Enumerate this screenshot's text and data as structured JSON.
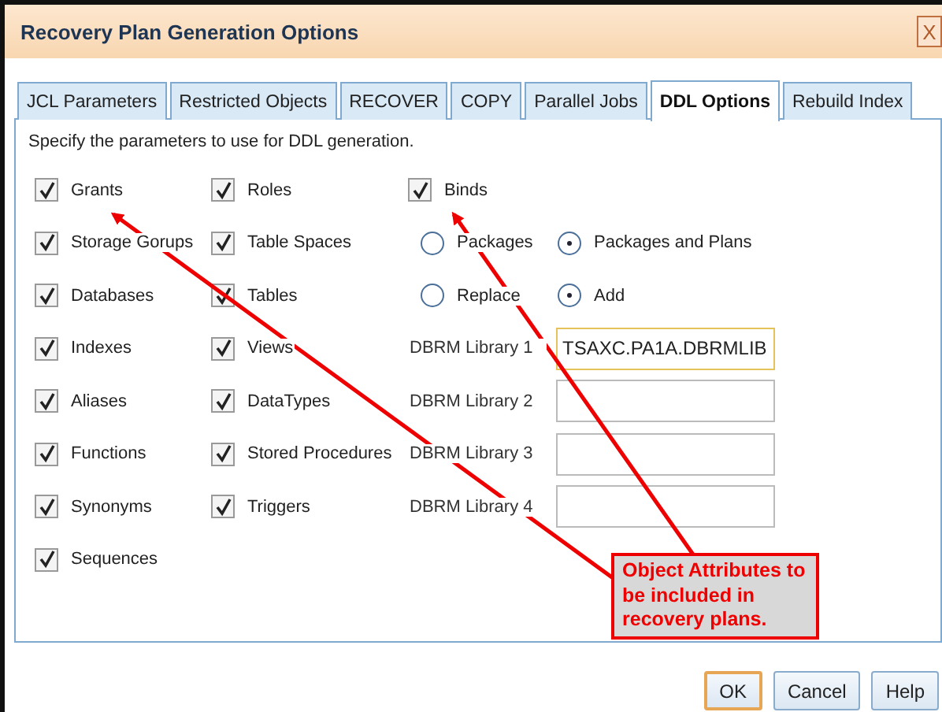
{
  "window": {
    "title": "Recovery Plan Generation Options",
    "close": "X"
  },
  "tabs": [
    {
      "label": "JCL Parameters",
      "selected": false
    },
    {
      "label": "Restricted Objects",
      "selected": false
    },
    {
      "label": "RECOVER",
      "selected": false
    },
    {
      "label": "COPY",
      "selected": false
    },
    {
      "label": "Parallel Jobs",
      "selected": false
    },
    {
      "label": "DDL Options",
      "selected": true
    },
    {
      "label": "Rebuild Index",
      "selected": false
    }
  ],
  "instruction": "Specify the parameters to use for DDL generation.",
  "object_columns": [
    {
      "items": [
        {
          "label": "Grants",
          "checked": true
        },
        {
          "label": "Storage Gorups",
          "checked": true
        },
        {
          "label": "Databases",
          "checked": true
        },
        {
          "label": "Indexes",
          "checked": true
        },
        {
          "label": "Aliases",
          "checked": true
        },
        {
          "label": "Functions",
          "checked": true
        },
        {
          "label": "Synonyms",
          "checked": true
        },
        {
          "label": "Sequences",
          "checked": true
        }
      ]
    },
    {
      "items": [
        {
          "label": "Roles",
          "checked": true
        },
        {
          "label": "Table Spaces",
          "checked": true
        },
        {
          "label": "Tables",
          "checked": true
        },
        {
          "label": "Views",
          "checked": true
        },
        {
          "label": "DataTypes",
          "checked": true
        },
        {
          "label": "Stored Procedures",
          "checked": true
        },
        {
          "label": "Triggers",
          "checked": true
        }
      ]
    }
  ],
  "binds": {
    "label": "Binds",
    "checked": true
  },
  "radio_groups": [
    {
      "options": [
        {
          "label": "Packages",
          "selected": false
        },
        {
          "label": "Packages and Plans",
          "selected": true
        }
      ]
    },
    {
      "options": [
        {
          "label": "Replace",
          "selected": false
        },
        {
          "label": "Add",
          "selected": true
        }
      ]
    }
  ],
  "dbrm_libraries": [
    {
      "label": "DBRM Library 1",
      "value": "TSAXC.PA1A.DBRMLIB",
      "focused": true
    },
    {
      "label": "DBRM Library 2",
      "focused": false
    },
    {
      "label": "DBRM Library 3",
      "focused": false
    },
    {
      "label": "DBRM Library 4",
      "focused": false
    }
  ],
  "callout": {
    "text": "Object Attributes to be included in recovery plans."
  },
  "buttons": [
    {
      "label": "OK",
      "kind": "default"
    },
    {
      "label": "Cancel",
      "kind": "normal"
    },
    {
      "label": "Help",
      "kind": "normal"
    }
  ]
}
